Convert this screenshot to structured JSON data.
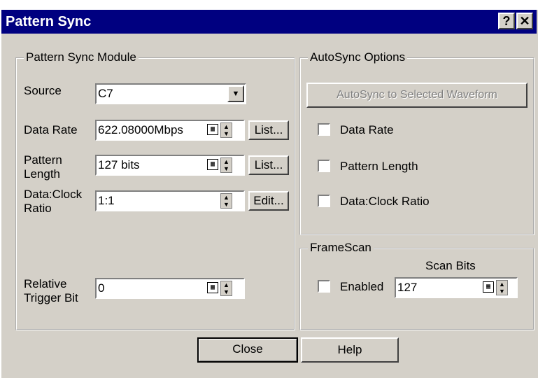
{
  "window": {
    "title": "Pattern Sync",
    "help_icon": "?",
    "close_icon": "✕"
  },
  "module": {
    "title": "Pattern Sync Module",
    "source_label": "Source",
    "source_value": "C7",
    "data_rate_label": "Data Rate",
    "data_rate_value": "622.08000Mbps",
    "data_rate_button": "List...",
    "pattern_length_label": "Pattern\nLength",
    "pattern_length_value": "127 bits",
    "pattern_length_button": "List...",
    "ratio_label": "Data:Clock\nRatio",
    "ratio_value": "1:1",
    "ratio_button": "Edit...",
    "trigger_label": "Relative\nTrigger Bit",
    "trigger_value": "0"
  },
  "autosync": {
    "title": "AutoSync Options",
    "button": "AutoSync to Selected Waveform",
    "options": [
      "Data Rate",
      "Pattern Length",
      "Data:Clock Ratio"
    ]
  },
  "framescan": {
    "title": "FrameScan",
    "scan_bits_label": "Scan Bits",
    "enabled_label": "Enabled",
    "scan_bits_value": "127"
  },
  "footer": {
    "close": "Close",
    "help": "Help"
  }
}
